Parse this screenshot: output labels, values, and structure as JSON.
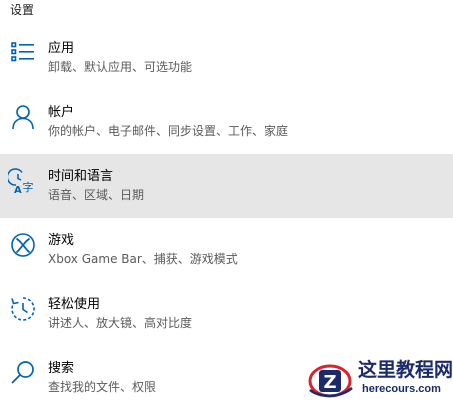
{
  "window": {
    "title": "设置"
  },
  "categories": [
    {
      "title": "应用",
      "description": "卸载、默认应用、可选功能",
      "icon": "apps-list-icon",
      "active": false
    },
    {
      "title": "帐户",
      "description": "你的帐户、电子邮件、同步设置、工作、家庭",
      "icon": "person-icon",
      "active": false
    },
    {
      "title": "时间和语言",
      "description": "语音、区域、日期",
      "icon": "time-language-icon",
      "active": true
    },
    {
      "title": "游戏",
      "description": "Xbox Game Bar、捕获、游戏模式",
      "icon": "xbox-icon",
      "active": false
    },
    {
      "title": "轻松使用",
      "description": "讲述人、放大镜、高对比度",
      "icon": "ease-of-access-icon",
      "active": false
    },
    {
      "title": "搜索",
      "description": "查找我的文件、权限",
      "icon": "search-icon",
      "active": false
    }
  ],
  "watermark": {
    "text": "这里教程网",
    "subtext": "herecours.com",
    "logo_letter": "Z"
  },
  "colors": {
    "accent": "#0063b1",
    "active_background": "#e6e6e6",
    "description_text": "#5a5a5a",
    "watermark_navy": "#1b2a6b",
    "watermark_red": "#d9232d"
  }
}
